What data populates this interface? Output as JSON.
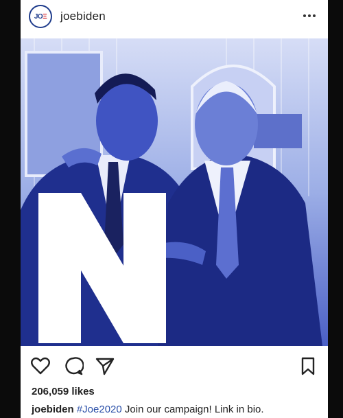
{
  "post": {
    "avatar_logo": "JOE",
    "username": "joebiden",
    "photo_overlay_letter": "N",
    "likes": "206,059 likes",
    "caption_user": "joebiden",
    "caption_hashtag": "#Joe2020",
    "caption_text": " Join our campaign! Link in bio."
  },
  "icons": {
    "more": "more-options-icon",
    "like": "heart-icon",
    "comment": "comment-icon",
    "share": "send-icon",
    "save": "bookmark-icon"
  },
  "colors": {
    "brand_blue": "#1f3c8c",
    "brand_red": "#d0202a",
    "photo_tint": "#3f55c4"
  }
}
